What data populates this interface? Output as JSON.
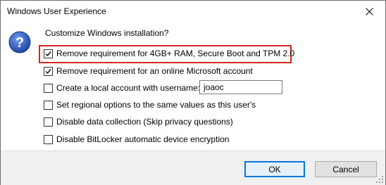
{
  "window": {
    "title": "Windows User Experience",
    "icons": {
      "close": "close-icon",
      "question": "question-icon",
      "grip": "resize-grip-icon"
    }
  },
  "dialog": {
    "prompt": "Customize Windows installation?",
    "options": [
      {
        "label": "Remove requirement for 4GB+ RAM, Secure Boot and TPM 2.0",
        "checked": true
      },
      {
        "label": "Remove requirement for an online Microsoft account",
        "checked": true
      },
      {
        "label": "Create a local account with username:",
        "checked": false
      },
      {
        "label": "Set regional options to the same values as this user's",
        "checked": false
      },
      {
        "label": "Disable data collection (Skip privacy questions)",
        "checked": false
      },
      {
        "label": "Disable BitLocker automatic device encryption",
        "checked": false
      }
    ],
    "username": {
      "value": "joaoc"
    },
    "highlight_color": "#d7261e"
  },
  "buttons": {
    "ok": "OK",
    "cancel": "Cancel"
  },
  "colors": {
    "ok_border": "#0078d7",
    "icon_blue": "#2b57b8"
  }
}
